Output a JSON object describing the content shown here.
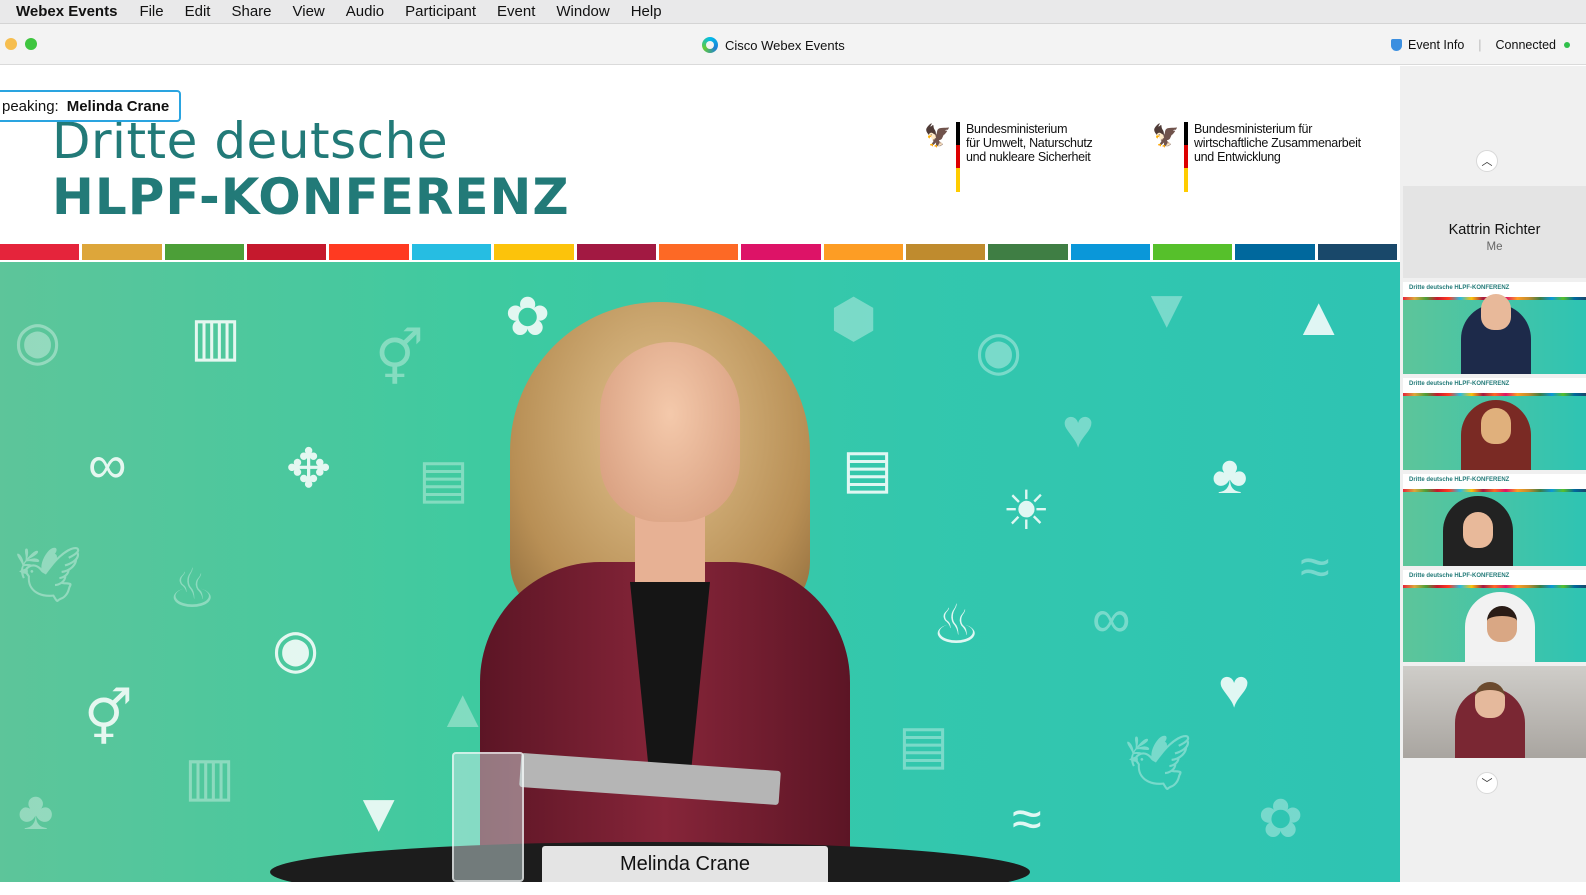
{
  "menubar": {
    "app_name": "Webex Events",
    "menus": [
      "File",
      "Edit",
      "Share",
      "View",
      "Audio",
      "Participant",
      "Event",
      "Window",
      "Help"
    ]
  },
  "window": {
    "title": "Cisco Webex Events",
    "event_info": "Event Info",
    "status": "Connected"
  },
  "stage": {
    "speaking_label": "peaking:",
    "speaker_name": "Melinda Crane",
    "conference_line1": "Dritte deutsche",
    "conference_line2": "HLPF-KONFERENZ",
    "ministry1": "Bundesministerium\nfür Umwelt, Naturschutz\nund nukleare Sicherheit",
    "ministry2": "Bundesministerium für\nwirtschaftliche Zusammenarbeit\nund Entwicklung",
    "nameplate": "Melinda Crane"
  },
  "panel": {
    "me_name": "Kattrin Richter",
    "me_label": "Me",
    "thumb_banner_text": "Dritte deutsche\nHLPF-KONFERENZ"
  },
  "colors": {
    "brand_teal": "#227a78",
    "speaking_border": "#2aa4e0",
    "connected_dot": "#2fbf4a",
    "sdg_stripes": [
      "#e5243b",
      "#dda63a",
      "#4c9f38",
      "#c5192d",
      "#ff3a21",
      "#26bde2",
      "#fcc30b",
      "#a21942",
      "#fd6925",
      "#dd1367",
      "#fd9d24",
      "#bf8b2e",
      "#3f7e44",
      "#0a97d9",
      "#56c02b",
      "#00689d",
      "#19486a"
    ]
  }
}
